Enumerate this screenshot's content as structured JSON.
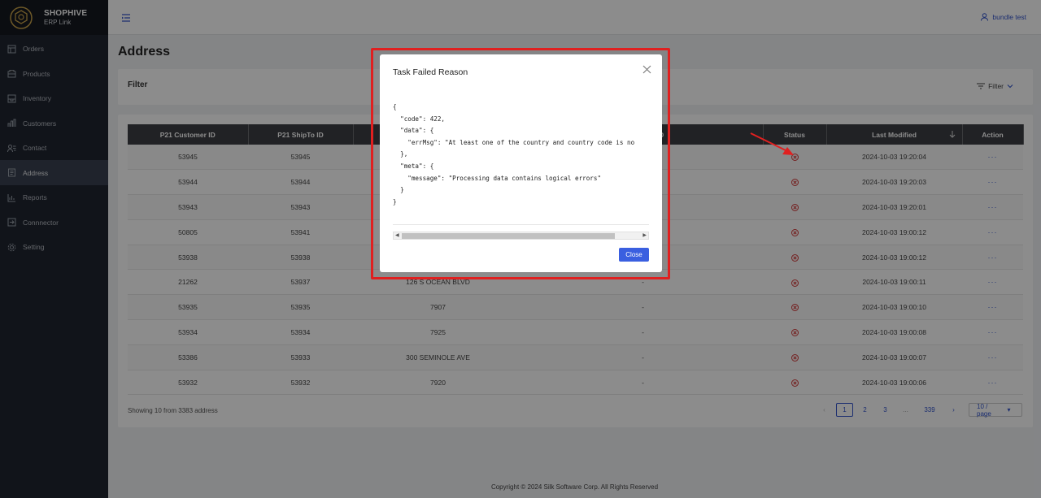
{
  "brand": {
    "name": "SHOPHIVE",
    "sub": "ERP Link"
  },
  "sidebar": {
    "items": [
      {
        "label": "Orders",
        "icon": "orders-icon"
      },
      {
        "label": "Products",
        "icon": "products-icon"
      },
      {
        "label": "Inventory",
        "icon": "inventory-icon"
      },
      {
        "label": "Customers",
        "icon": "customers-icon"
      },
      {
        "label": "Contact",
        "icon": "contact-icon"
      },
      {
        "label": "Address",
        "icon": "address-icon",
        "active": true
      },
      {
        "label": "Reports",
        "icon": "reports-icon"
      },
      {
        "label": "Connnector",
        "icon": "connector-icon"
      },
      {
        "label": "Setting",
        "icon": "setting-icon"
      }
    ]
  },
  "header": {
    "user": "bundle test"
  },
  "page": {
    "title": "Address"
  },
  "filter": {
    "label": "Filter",
    "button": "Filter"
  },
  "table": {
    "columns": [
      "P21 Customer ID",
      "P21 ShipTo ID",
      "",
      "y Address ID",
      "Status",
      "Last Modified",
      "Action"
    ],
    "rows": [
      {
        "cust": "53945",
        "ship": "53945",
        "addr": "",
        "addr_id": "",
        "modified": "2024-10-03 19:20:04"
      },
      {
        "cust": "53944",
        "ship": "53944",
        "addr": "",
        "addr_id": "",
        "modified": "2024-10-03 19:20:03"
      },
      {
        "cust": "53943",
        "ship": "53943",
        "addr": "",
        "addr_id": "",
        "modified": "2024-10-03 19:20:01"
      },
      {
        "cust": "50805",
        "ship": "53941",
        "addr": "",
        "addr_id": "",
        "modified": "2024-10-03 19:00:12"
      },
      {
        "cust": "53938",
        "ship": "53938",
        "addr": "",
        "addr_id": "",
        "modified": "2024-10-03 19:00:12"
      },
      {
        "cust": "21262",
        "ship": "53937",
        "addr": "126 S OCEAN BLVD",
        "addr_id": "-",
        "modified": "2024-10-03 19:00:11"
      },
      {
        "cust": "53935",
        "ship": "53935",
        "addr": "7907",
        "addr_id": "-",
        "modified": "2024-10-03 19:00:10"
      },
      {
        "cust": "53934",
        "ship": "53934",
        "addr": "7925",
        "addr_id": "-",
        "modified": "2024-10-03 19:00:08"
      },
      {
        "cust": "53386",
        "ship": "53933",
        "addr": "300 SEMINOLE AVE",
        "addr_id": "-",
        "modified": "2024-10-03 19:00:07"
      },
      {
        "cust": "53932",
        "ship": "53932",
        "addr": "7920",
        "addr_id": "-",
        "modified": "2024-10-03 19:00:06"
      }
    ],
    "action_label": "···",
    "showing": "Showing 10 from 3383 address"
  },
  "pagination": {
    "pages": [
      "1",
      "2",
      "3",
      "...",
      "339"
    ],
    "current": "1",
    "page_size": "10 / page"
  },
  "footer": "Copyright © 2024 Silk Software Corp. All Rights Reserved",
  "modal": {
    "title": "Task Failed Reason",
    "code": "{\n  \"code\": 422,\n  \"data\": {\n    \"errMsg\": \"At least one of the country and country code is no\n  },\n  \"meta\": {\n    \"message\": \"Processing data contains logical errors\"\n  }\n}",
    "close_label": "Close"
  },
  "colors": {
    "accent": "#3a5fe0",
    "sidebar": "#1f2530",
    "header_row": "#3d3f44",
    "error": "#d43a3a",
    "highlight": "#e02020"
  }
}
